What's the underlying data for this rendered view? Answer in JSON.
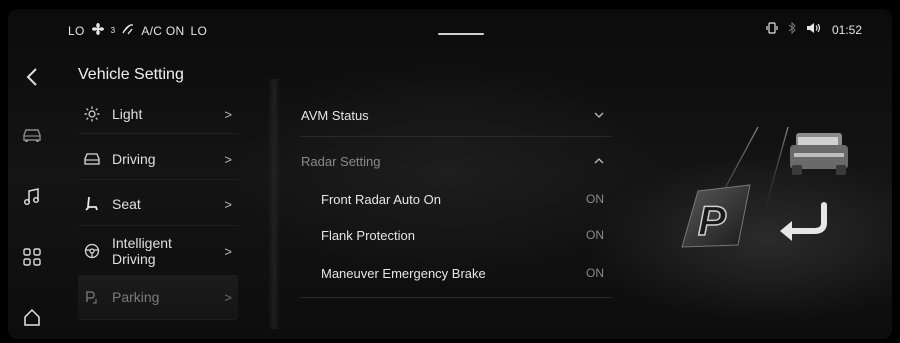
{
  "status_bar": {
    "left_temp": "LO",
    "fan_level": "3",
    "ac_label": "A/C ON",
    "right_temp": "LO",
    "time": "01:52"
  },
  "left_rail": {
    "icons": [
      "back-icon",
      "car-icon",
      "music-icon",
      "apps-icon",
      "home-icon"
    ]
  },
  "menu": {
    "title": "Vehicle Setting",
    "items": [
      {
        "label": "Light",
        "icon": "sun-icon"
      },
      {
        "label": "Driving",
        "icon": "car-outline-icon"
      },
      {
        "label": "Seat",
        "icon": "seat-icon"
      },
      {
        "label": "Intelligent Driving",
        "label_line1": "Intelligent",
        "label_line2": "Driving",
        "icon": "steering-wheel-icon"
      },
      {
        "label": "Parking",
        "icon": "parking-icon"
      }
    ],
    "active_index": 4
  },
  "panel": {
    "avm_status": "AVM Status",
    "radar_setting": "Radar Setting",
    "rows": [
      {
        "label": "Front Radar Auto On",
        "value": "ON"
      },
      {
        "label": "Flank Protection",
        "value": "ON"
      },
      {
        "label": "Maneuver Emergency Brake",
        "value": "ON"
      }
    ]
  },
  "illustration": {
    "parking_letter": "P"
  },
  "colors": {
    "background": "#0d0d0d",
    "text": "#e6e6e6",
    "muted": "#8a8a8a"
  }
}
